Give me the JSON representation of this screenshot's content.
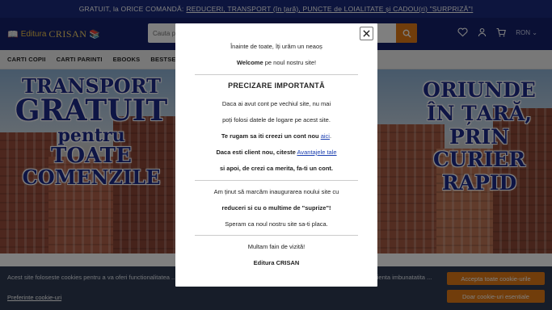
{
  "topbar": {
    "text": "GRATUIT, la ORICE COMANDĂ:",
    "link": "REDUCERI, TRANSPORT (în țară), PUNCTE de LOIALITATE și CADOU(ri) \"SURPRIZĂ\"!"
  },
  "header": {
    "brand_prefix": "Editura",
    "brand_name": "CRISAN",
    "search_placeholder": "Cauta produse...",
    "currency": "RON",
    "icons": [
      "heart-icon",
      "user-icon",
      "cart-icon",
      "search-icon"
    ]
  },
  "nav": {
    "items": [
      "CARTI COPII",
      "CARTI PARINTI",
      "EBOOKS",
      "BESTSELLERS"
    ]
  },
  "hero": {
    "left_lines": [
      "TRANSPORT",
      "GRATUIT",
      "pentru",
      "TOATE",
      "COMENZILE"
    ],
    "right_lines": [
      "ORIUNDE",
      "ÎN ȚARĂ,",
      "PRIN",
      "CURIER",
      "RAPID"
    ]
  },
  "cookie": {
    "text": "Acest site foloseste cookies pentru a va oferi functionalitatea ... Folosim cookies si cu plasarea de cookies, cu scopul de a va oferi o experienta imbunatatita ...",
    "preferences": "Preferinte cookie-uri",
    "accept_all": "Accepta toate cookie-urile",
    "accept_essential": "Doar cookie-uri esentiale"
  },
  "modal": {
    "intro": "Înainte de toate, îți urăm un neaoș",
    "welcome_bold": "Welcome",
    "welcome_rest": "pe noul nostru site!",
    "title": "PRECIZARE IMPORTANTĂ",
    "p1": "Daca ai avut cont pe vechiul site, nu mai",
    "p2": "poți folosi datele de logare pe acest site.",
    "p3_bold": "Te rugam sa iti creezi un cont nou",
    "p3_link": "aici",
    "p4_bold": "Daca esti client nou, citeste",
    "p4_link": "Avantajele tale",
    "p5_bold": "si apoi, de crezi ca merita, fa-ti un cont.",
    "p6": "Am ținut să marcăm inaugurarea noului site cu",
    "p7_bold": "reduceri si cu o multime de \"suprize\"!",
    "p8": "Speram ca noul nostru site sa-ti placa.",
    "p9": "Multam fain de vizită!",
    "signature": "Editura CRISAN"
  },
  "colors": {
    "topbar": "#1b2a7c",
    "header": "#15216b",
    "accent": "#e37a16",
    "hero_text": "#1d2a8a",
    "cookie_bg": "#2e3b52"
  }
}
